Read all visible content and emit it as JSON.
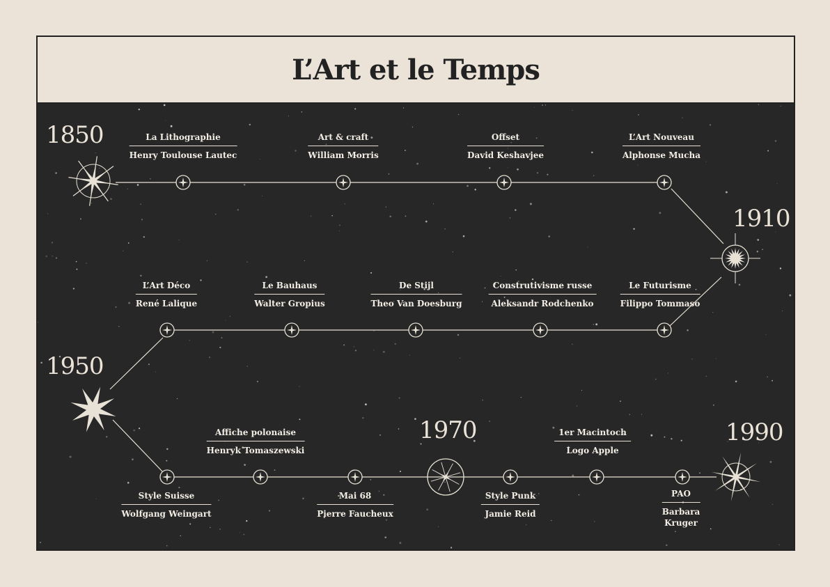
{
  "title": "L’Art et le Temps",
  "years": {
    "y1850": "1850",
    "y1910": "1910",
    "y1950": "1950",
    "y1970": "1970",
    "y1990": "1990"
  },
  "events": {
    "lithographie": {
      "movement": "La Lithographie",
      "artist": "Henry Toulouse Lautec"
    },
    "art_craft": {
      "movement": "Art & craft",
      "artist": "William Morris"
    },
    "offset": {
      "movement": "Offset",
      "artist": "David Keshavjee"
    },
    "art_nouveau": {
      "movement": "L’Art Nouveau",
      "artist": "Alphonse Mucha"
    },
    "art_deco": {
      "movement": "L’Art Déco",
      "artist": "René Lalique"
    },
    "bauhaus": {
      "movement": "Le Bauhaus",
      "artist": "Walter Gropius"
    },
    "de_stijl": {
      "movement": "De Stijl",
      "artist": "Theo Van Doesburg"
    },
    "constructivisme": {
      "movement": "Construtivisme russe",
      "artist": "Aleksandr Rodchenko"
    },
    "futurisme": {
      "movement": "Le Futurisme",
      "artist": "Filippo Tommaso"
    },
    "style_suisse": {
      "movement": "Style Suisse",
      "artist": "Wolfgang Weingart"
    },
    "affiche_polonaise": {
      "movement": "Affiche polonaise",
      "artist": "Henryk Tomaszewski"
    },
    "mai_68": {
      "movement": "Mai 68",
      "artist": "Pierre Faucheux"
    },
    "style_punk": {
      "movement": "Style Punk",
      "artist": "Jamie Reid"
    },
    "macintoch": {
      "movement": "1er Macintoch",
      "artist": "Logo Apple"
    },
    "pao": {
      "movement": "PAO",
      "artist": "Barbara",
      "artist2": "Kruger"
    }
  },
  "colors": {
    "background": "#272727",
    "paper": "#ebe3d8",
    "ink": "#e8e2d6"
  },
  "icons": [
    "compass-star-icon",
    "sun-burst-icon",
    "eight-point-star-icon",
    "four-point-star-icon"
  ]
}
